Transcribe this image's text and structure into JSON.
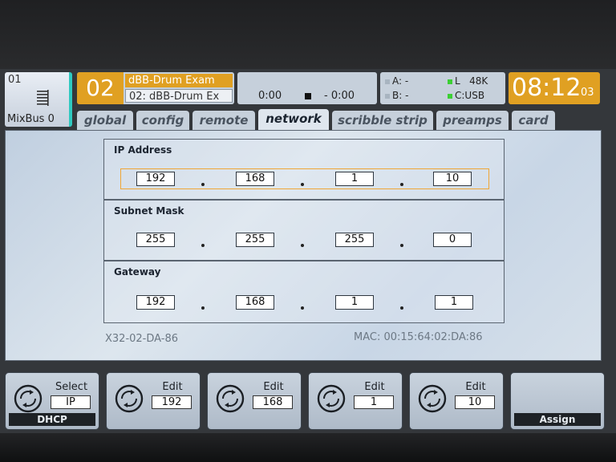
{
  "header": {
    "channel": {
      "number": "01",
      "name": "MixBus 0"
    },
    "scene": {
      "number": "02",
      "title": "dBB-Drum Exam",
      "subtitle": "02: dBB-Drum Ex"
    },
    "transport": {
      "elapsed": "0:00",
      "remaining": "- 0:00"
    },
    "io": {
      "a_label": "A:",
      "a_value": "-",
      "b_label": "B:",
      "b_value": "-",
      "l_label": "L",
      "rate": "48K",
      "c_label": "C:",
      "c_value": "USB"
    },
    "clock": {
      "time": "08:12",
      "seconds": "03"
    }
  },
  "tabs": [
    "global",
    "config",
    "remote",
    "network",
    "scribble strip",
    "preamps",
    "card"
  ],
  "active_tab": "network",
  "network": {
    "ip_address": {
      "label": "IP Address",
      "octets": [
        "192",
        "168",
        "1",
        "10"
      ]
    },
    "subnet_mask": {
      "label": "Subnet Mask",
      "octets": [
        "255",
        "255",
        "255",
        "0"
      ]
    },
    "gateway": {
      "label": "Gateway",
      "octets": [
        "192",
        "168",
        "1",
        "1"
      ]
    },
    "device_name": "X32-02-DA-86",
    "mac": "MAC: 00:15:64:02:DA:86"
  },
  "encoders": [
    {
      "label": "Select",
      "value": "IP",
      "footer": "DHCP"
    },
    {
      "label": "Edit",
      "value": "192",
      "footer": ""
    },
    {
      "label": "Edit",
      "value": "168",
      "footer": ""
    },
    {
      "label": "Edit",
      "value": "1",
      "footer": ""
    },
    {
      "label": "Edit",
      "value": "10",
      "footer": ""
    },
    {
      "label": "",
      "value": "",
      "footer": "Assign"
    }
  ],
  "colors": {
    "accent": "#e0a022",
    "highlight": "#f0a636",
    "channel_bar": "#2fc9c0",
    "indicator_green": "#3ccf34"
  }
}
